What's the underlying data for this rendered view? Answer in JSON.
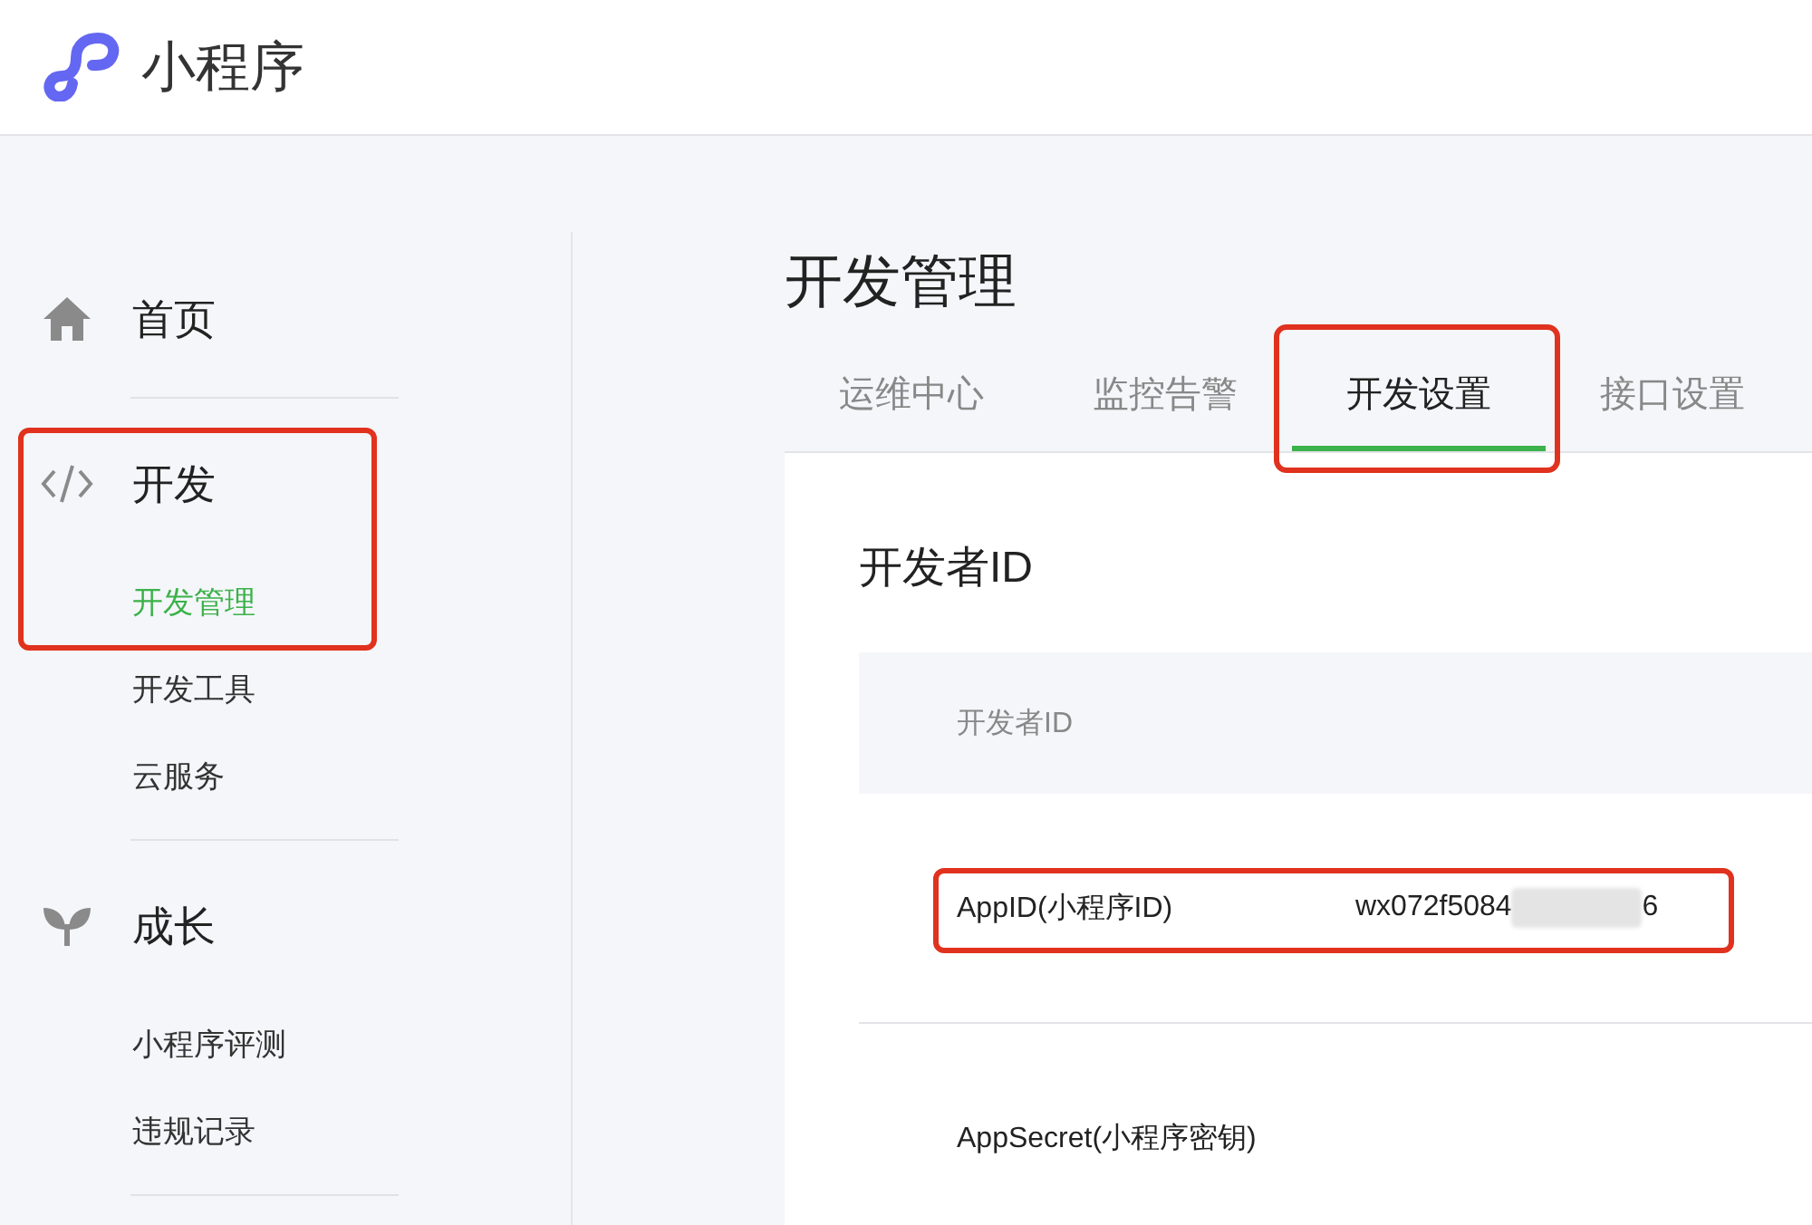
{
  "header": {
    "title": "小程序"
  },
  "sidebar": {
    "sections": [
      {
        "label": "首页",
        "highlighted": false
      },
      {
        "label": "开发",
        "highlighted": true,
        "items": [
          {
            "label": "开发管理",
            "selected": true
          },
          {
            "label": "开发工具",
            "selected": false
          },
          {
            "label": "云服务",
            "selected": false
          }
        ]
      },
      {
        "label": "成长",
        "highlighted": false,
        "items": [
          {
            "label": "小程序评测",
            "selected": false
          },
          {
            "label": "违规记录",
            "selected": false
          }
        ]
      }
    ]
  },
  "main": {
    "title": "开发管理",
    "tabs": [
      {
        "label": "运维中心",
        "selected": false,
        "highlighted": false
      },
      {
        "label": "监控告警",
        "selected": false,
        "highlighted": false
      },
      {
        "label": "开发设置",
        "selected": true,
        "highlighted": true
      },
      {
        "label": "接口设置",
        "selected": false,
        "highlighted": false
      }
    ],
    "card": {
      "heading": "开发者ID",
      "table_header": "开发者ID",
      "rows": [
        {
          "label": "AppID(小程序ID)",
          "value": "wx072f5084",
          "redacted": true,
          "value_end": "6",
          "highlighted": true
        },
        {
          "label": "AppSecret(小程序密钥)",
          "highlighted": false
        }
      ]
    }
  }
}
